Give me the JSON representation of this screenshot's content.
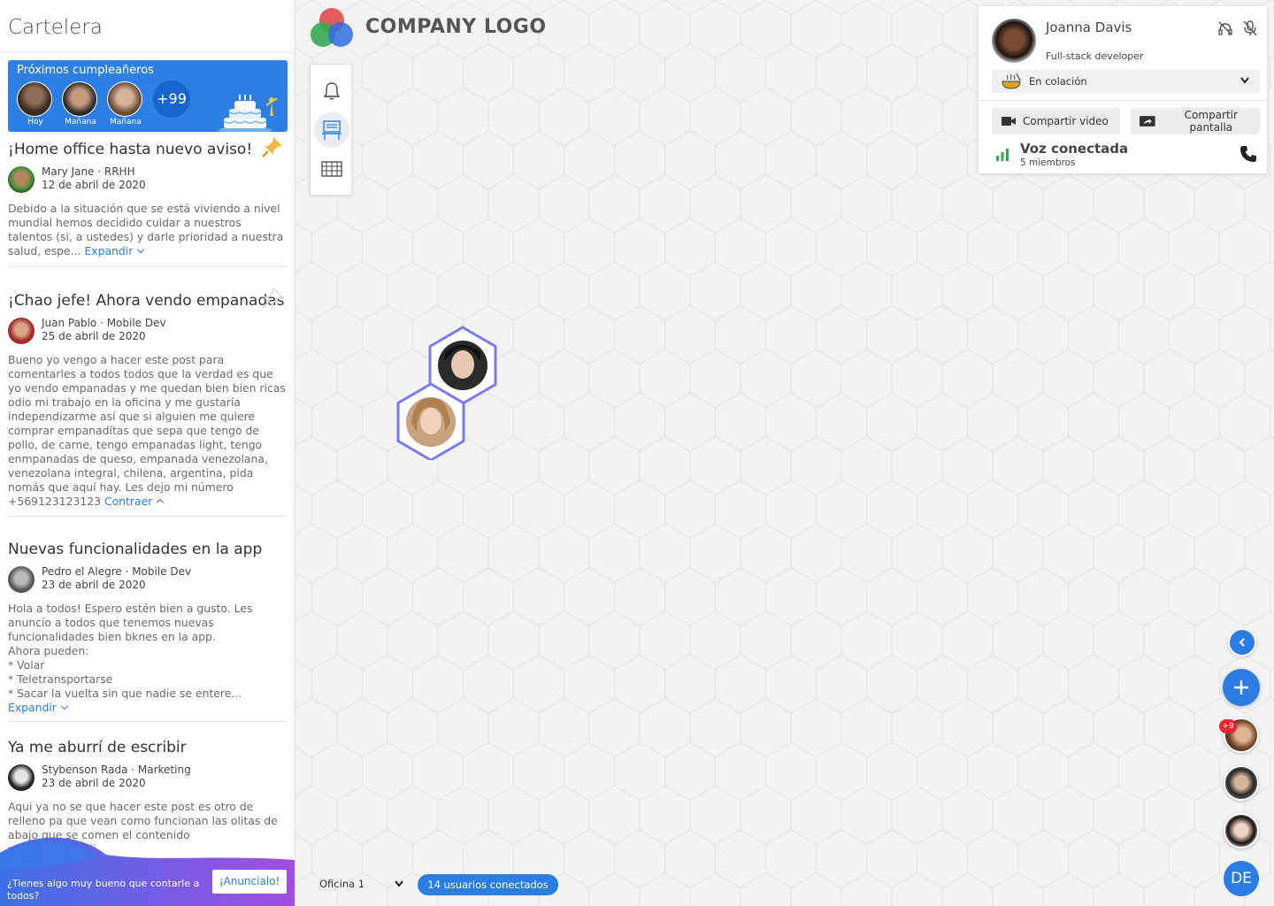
{
  "sidebar": {
    "title": "Cartelera",
    "birthdays": {
      "title": "Próximos cumpleañeros",
      "people": [
        {
          "label": "Hoy"
        },
        {
          "label": "Mañana"
        },
        {
          "label": "Mañana"
        }
      ],
      "more": "+99"
    },
    "posts": [
      {
        "title": "¡Home office hasta nuevo aviso!",
        "author": "Mary Jane · RRHH",
        "date": "12 de abril de 2020",
        "body": "Debido a la situación que se está viviendo a nivel\nmundial hemos decidido cuidar a nuestros\ntalentos (si, a ustedes) y darle prioridad a nuestra\nsalud, espe...",
        "toggle": "Expandir",
        "pinned": true
      },
      {
        "title": "¡Chao jefe! Ahora vendo empanadas",
        "author": "Juan Pablo · Mobile Dev",
        "date": "25 de abril de 2020",
        "body": "Bueno yo vengo a hacer este post para\ncomentarles a todos todos que la verdad es que\nyo vendo empanadas y me quedan bien bien ricas\nodio mi trabajo en la oficina y me gustaría\nindependizarme así que si alguien me quiere\ncomprar empanaditas que sepa que tengo de\npollo, de carne, tengo empanadas light, tengo\nenmpanadas de queso, empanada venezolana,\nvenezolana integral, chilena, argentina, pida\nnomás que aquí hay. Les dejo mi número\n+569123123123",
        "toggle": "Contraer",
        "pinned": false
      },
      {
        "title": "Nuevas funcionalidades en la app",
        "author": "Pedro el Alegre · Mobile Dev",
        "date": "23 de abril de 2020",
        "body": "Hola a todos! Espero estén bien a gusto. Les\nanuncio a todos que tenemos nuevas\nfuncionalidades bien bknes en la app.\nAhora pueden:\n* Volar\n* Teletransportarse\n* Sacar la vuelta sin que nadie se entere...",
        "toggle": "Expandir"
      },
      {
        "title": "Ya me aburrí de escribir",
        "author": "Stybenson Rada · Marketing",
        "date": "23 de abril de 2020",
        "body": "Aqui ya no se que hacer este post es otro de\nrelleno pa que vean como funcionan las olitas de\nabajo que se comen el contenido\nwiiiiiiiiiiiiiiiiiiiiiiiiii"
      }
    ],
    "cta": {
      "text": "¿Tienes algo muy bueno que contarle a todos?",
      "button": "¡Anuncialo!"
    }
  },
  "header": {
    "logo_text": "COMPANY LOGO"
  },
  "toolbar": {
    "items": [
      "bell-icon",
      "desk-icon",
      "grid-map-icon"
    ],
    "active": "desk-icon"
  },
  "profile": {
    "name": "Joanna Davis",
    "role": "Full-stack developer",
    "status": "En colación",
    "share_video": "Compartir video",
    "share_screen": "Compartir pantalla",
    "voice_title": "Voz conectada",
    "voice_members": "5 miembros"
  },
  "right_rail": {
    "badge": "+9",
    "me": "DE"
  },
  "bottom": {
    "office": "Oficina 1",
    "users": "14 usuarios conectados"
  },
  "colors": {
    "accent": "#2b7de4",
    "hex_ring": "#7b7bf0",
    "voice_green": "#2fa84f",
    "badge_red": "#e6262f",
    "cta_purple": "#9d4ee0"
  }
}
